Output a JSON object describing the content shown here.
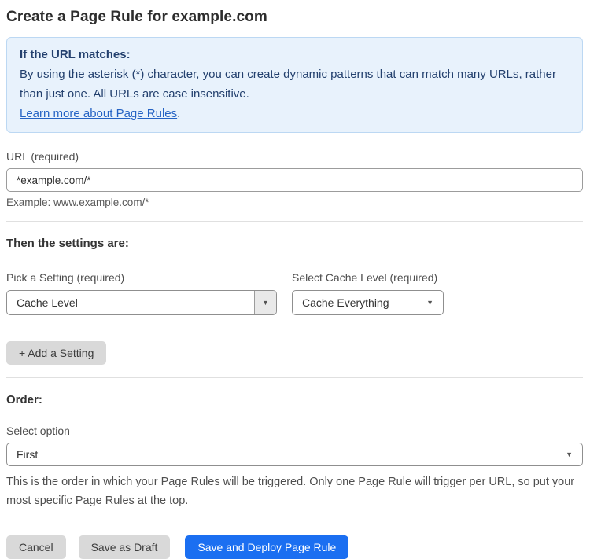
{
  "page": {
    "title": "Create a Page Rule for example.com"
  },
  "info_box": {
    "heading": "If the URL matches:",
    "body": "By using the asterisk (*) character, you can create dynamic patterns that can match many URLs, rather than just one. All URLs are case insensitive.",
    "link": "Learn more about Page Rules",
    "link_suffix": "."
  },
  "url_field": {
    "label": "URL (required)",
    "value": "*example.com/*",
    "hint": "Example: www.example.com/*"
  },
  "settings_section": {
    "heading": "Then the settings are:",
    "setting_label": "Pick a Setting (required)",
    "setting_value": "Cache Level",
    "cache_label": "Select Cache Level (required)",
    "cache_value": "Cache Everything",
    "add_setting_label": "+ Add a Setting"
  },
  "order_section": {
    "heading": "Order:",
    "label": "Select option",
    "value": "First",
    "help": "This is the order in which your Page Rules will be triggered. Only one Page Rule will trigger per URL, so put your most specific Page Rules at the top."
  },
  "footer": {
    "cancel_label": "Cancel",
    "save_draft_label": "Save as Draft",
    "save_deploy_label": "Save and Deploy Page Rule"
  },
  "icons": {
    "caret_down": "▼"
  },
  "colors": {
    "accent_blue": "#1b6ff1",
    "info_background": "#e8f2fc",
    "info_border": "#bcd8f3",
    "info_text": "#23406e",
    "link_blue": "#2563c4",
    "button_gray": "#d9d9d9"
  }
}
